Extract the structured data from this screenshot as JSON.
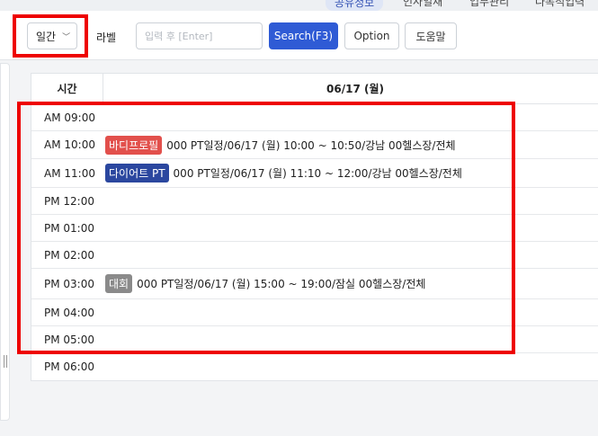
{
  "topnav": {
    "tabs": [
      "공유정보",
      "인사일재",
      "업무관리",
      "다목적입력"
    ]
  },
  "toolbar": {
    "view_select": "일간",
    "label_text": "라벨",
    "input_placeholder": "입력 후 [Enter]",
    "search_button": "Search(F3)",
    "option_button": "Option",
    "help_button": "도움말"
  },
  "calendar": {
    "time_header": "시간",
    "date_header": "06/17 (월)",
    "slots": [
      {
        "time": "AM 09:00"
      },
      {
        "time": "AM 10:00",
        "event": {
          "badge": "바디프로필",
          "badge_color": "#e2504c",
          "text": "000 PT일정/06/17 (월) 10:00 ~ 10:50/강남 00헬스장/전체"
        }
      },
      {
        "time": "AM 11:00",
        "event": {
          "badge": "다이어트 PT",
          "badge_color": "#2b479f",
          "text": "000 PT일정/06/17 (월) 11:10 ~ 12:00/강남 00헬스장/전체"
        }
      },
      {
        "time": "PM 12:00"
      },
      {
        "time": "PM 01:00"
      },
      {
        "time": "PM 02:00"
      },
      {
        "time": "PM 03:00",
        "event": {
          "badge": "대회",
          "badge_color": "#8a8a8a",
          "text": "000 PT일정/06/17 (월) 15:00 ~ 19:00/잠실 00헬스장/전체"
        }
      },
      {
        "time": "PM 04:00"
      },
      {
        "time": "PM 05:00"
      },
      {
        "time": "PM 06:00"
      }
    ]
  },
  "colors": {
    "accent": "#2f5bd5",
    "highlight": "#ee0000"
  }
}
